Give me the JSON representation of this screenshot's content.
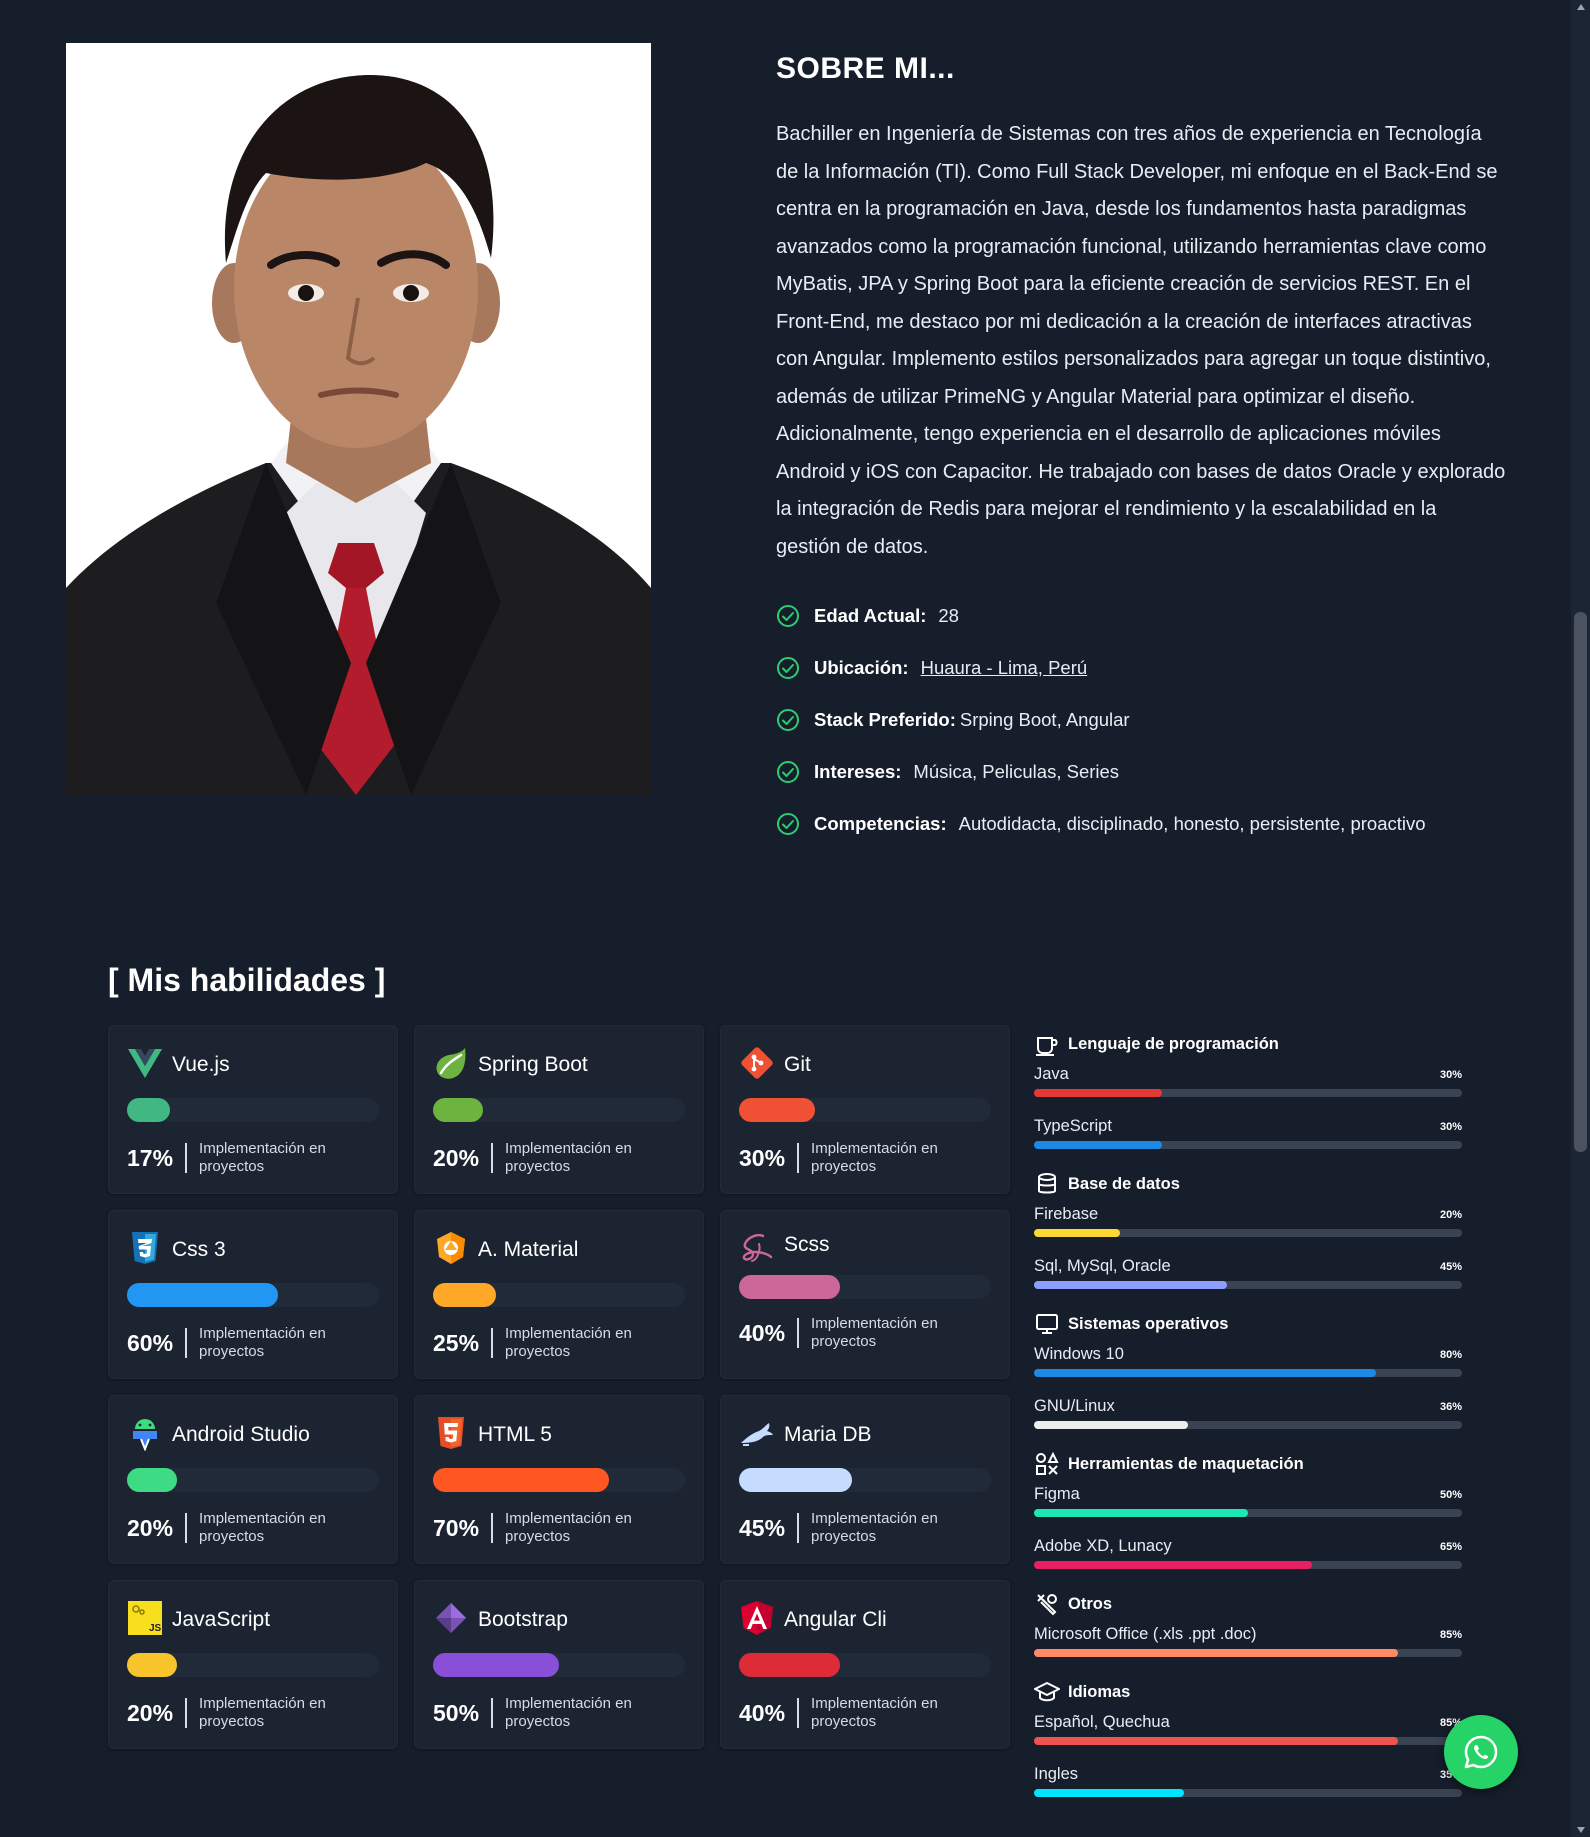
{
  "about": {
    "title": "SOBRE MI...",
    "bio": "Bachiller en Ingeniería de Sistemas con tres años de experiencia en Tecnología de la Información (TI). Como Full Stack Developer, mi enfoque en el Back-End se centra en la programación en Java, desde los fundamentos hasta paradigmas avanzados como la programación funcional, utilizando herramientas clave como MyBatis, JPA y Spring Boot para la eficiente creación de servicios REST. En el Front-End, me destaco por mi dedicación a la creación de interfaces atractivas con Angular. Implemento estilos personalizados para agregar un toque distintivo, además de utilizar PrimeNG y Angular Material para optimizar el diseño. Adicionalmente, tengo experiencia en el desarrollo de aplicaciones móviles Android y iOS con Capacitor. He trabajado con bases de datos Oracle y explorado la integración de Redis para mejorar el rendimiento y la escalabilidad en la gestión de datos.",
    "facts": [
      {
        "label": "Edad Actual:",
        "value": "28"
      },
      {
        "label": "Ubicación:",
        "value": "Huaura - Lima, Perú"
      },
      {
        "label": "Stack Preferido:",
        "value": "Srping Boot, Angular"
      },
      {
        "label": "Intereses:",
        "value": "Música, Peliculas, Series"
      },
      {
        "label": "Competencias:",
        "value": "Autodidacta, disciplinado, honesto, persistente, proactivo"
      }
    ]
  },
  "skills": {
    "title": "[ Mis habilidades ]",
    "caption": "Implementación en proyectos",
    "cards": [
      {
        "name": "Vue.js",
        "pct_label": "17%",
        "level": 17,
        "color": "#41b883",
        "icon": "vue-icon"
      },
      {
        "name": "Spring Boot",
        "pct_label": "20%",
        "level": 20,
        "color": "#6db33f",
        "icon": "spring-boot-icon"
      },
      {
        "name": "Git",
        "pct_label": "30%",
        "level": 30,
        "color": "#f05033",
        "icon": "git-icon"
      },
      {
        "name": "Css 3",
        "pct_label": "60%",
        "level": 60,
        "color": "#2196f3",
        "icon": "css3-icon"
      },
      {
        "name": "A. Material",
        "pct_label": "25%",
        "level": 25,
        "color": "#ffa726",
        "icon": "angular-material-icon"
      },
      {
        "name": "Scss",
        "pct_label": "40%",
        "level": 40,
        "color": "#cd6799",
        "icon": "sass-icon"
      },
      {
        "name": "Android Studio",
        "pct_label": "20%",
        "level": 20,
        "color": "#3ddc84",
        "icon": "android-studio-icon"
      },
      {
        "name": "HTML 5",
        "pct_label": "70%",
        "level": 70,
        "color": "#ff5722",
        "icon": "html5-icon"
      },
      {
        "name": "Maria DB",
        "pct_label": "45%",
        "level": 45,
        "color": "#c6dcff",
        "icon": "mariadb-icon"
      },
      {
        "name": "JavaScript",
        "pct_label": "20%",
        "level": 20,
        "color": "#f7c52b",
        "icon": "javascript-icon"
      },
      {
        "name": "Bootstrap",
        "pct_label": "50%",
        "level": 50,
        "color": "#8a4fd8",
        "icon": "bootstrap-icon"
      },
      {
        "name": "Angular Cli",
        "pct_label": "40%",
        "level": 40,
        "color": "#dd2c37",
        "icon": "angular-icon"
      }
    ]
  },
  "categories": [
    {
      "name": "Lenguaje de programación",
      "icon": "coffee-cup-icon",
      "items": [
        {
          "name": "Java",
          "pct_label": "30%",
          "level": 30,
          "color": "#e53935"
        },
        {
          "name": "TypeScript",
          "pct_label": "30%",
          "level": 30,
          "color": "#1e88e5"
        }
      ]
    },
    {
      "name": "Base de datos",
      "icon": "database-icon",
      "items": [
        {
          "name": "Firebase",
          "pct_label": "20%",
          "level": 20,
          "color": "#fdd835"
        },
        {
          "name": "Sql, MySql, Oracle",
          "pct_label": "45%",
          "level": 45,
          "color": "#8c9eff"
        }
      ]
    },
    {
      "name": "Sistemas operativos",
      "icon": "monitor-icon",
      "items": [
        {
          "name": "Windows 10",
          "pct_label": "80%",
          "level": 80,
          "color": "#1e88e5"
        },
        {
          "name": "GNU/Linux",
          "pct_label": "36%",
          "level": 36,
          "color": "#eeeeee"
        }
      ]
    },
    {
      "name": "Herramientas de maquetación",
      "icon": "shapes-icon",
      "items": [
        {
          "name": "Figma",
          "pct_label": "50%",
          "level": 50,
          "color": "#1de9b6"
        },
        {
          "name": "Adobe XD, Lunacy",
          "pct_label": "65%",
          "level": 65,
          "color": "#e91e63"
        }
      ]
    },
    {
      "name": "Otros",
      "icon": "tools-icon",
      "items": [
        {
          "name": "Microsoft Office (.xls .ppt .doc)",
          "pct_label": "85%",
          "level": 85,
          "color": "#ff8a65"
        }
      ]
    },
    {
      "name": "Idiomas",
      "icon": "graduation-cap-icon",
      "items": [
        {
          "name": "Español, Quechua",
          "pct_label": "85%",
          "level": 85,
          "color": "#ef5350"
        },
        {
          "name": "Ingles",
          "pct_label": "35%",
          "level": 35,
          "color": "#00e5ff"
        }
      ]
    }
  ],
  "colors": {
    "background": "#161e2c",
    "card": "#1c2432",
    "check": "#2ecc71",
    "whatsapp": "#25d366"
  }
}
